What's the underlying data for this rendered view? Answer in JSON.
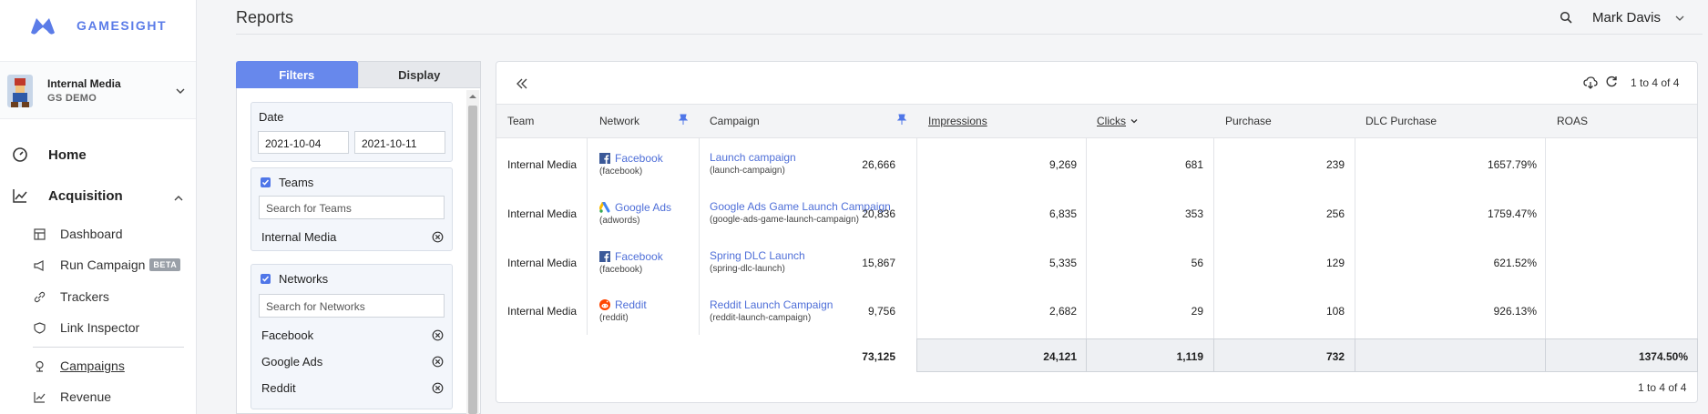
{
  "brand": {
    "name": "GAMESIGHT"
  },
  "org": {
    "name": "Internal Media",
    "sub": "GS DEMO"
  },
  "nav": {
    "home": "Home",
    "acquisition": "Acquisition",
    "dashboard": "Dashboard",
    "run_campaign": "Run Campaign",
    "beta": "BETA",
    "trackers": "Trackers",
    "link_inspector": "Link Inspector",
    "campaigns": "Campaigns",
    "revenue": "Revenue"
  },
  "header": {
    "title": "Reports",
    "user": "Mark Davis"
  },
  "filters": {
    "tab_filters": "Filters",
    "tab_display": "Display",
    "date_label": "Date",
    "date_start": "2021-10-04",
    "date_end": "2021-10-11",
    "teams_label": "Teams",
    "teams_placeholder": "Search for Teams",
    "teams_selected": [
      "Internal Media"
    ],
    "networks_label": "Networks",
    "networks_placeholder": "Search for Networks",
    "networks_selected": [
      "Facebook",
      "Google Ads",
      "Reddit"
    ]
  },
  "table": {
    "pager_top": "1 to 4 of 4",
    "pager_bottom": "1 to 4 of 4",
    "columns": [
      "Team",
      "Network",
      "Campaign",
      "Impressions",
      "Clicks",
      "Purchase",
      "DLC Purchase",
      "ROAS"
    ],
    "rows": [
      {
        "team": "Internal Media",
        "network": "Facebook",
        "network_slug": "(facebook)",
        "campaign": "Launch campaign",
        "campaign_slug": "(launch-campaign)",
        "impressions": "26,666",
        "clicks": "9,269",
        "purchase": "681",
        "dlc": "239",
        "roas": "1657.79%"
      },
      {
        "team": "Internal Media",
        "network": "Google Ads",
        "network_slug": "(adwords)",
        "campaign": "Google Ads Game Launch Campaign",
        "campaign_slug": "(google-ads-game-launch-campaign)",
        "impressions": "20,836",
        "clicks": "6,835",
        "purchase": "353",
        "dlc": "256",
        "roas": "1759.47%"
      },
      {
        "team": "Internal Media",
        "network": "Facebook",
        "network_slug": "(facebook)",
        "campaign": "Spring DLC Launch",
        "campaign_slug": "(spring-dlc-launch)",
        "impressions": "15,867",
        "clicks": "5,335",
        "purchase": "56",
        "dlc": "129",
        "roas": "621.52%"
      },
      {
        "team": "Internal Media",
        "network": "Reddit",
        "network_slug": "(reddit)",
        "campaign": "Reddit Launch Campaign",
        "campaign_slug": "(reddit-launch-campaign)",
        "impressions": "9,756",
        "clicks": "2,682",
        "purchase": "29",
        "dlc": "108",
        "roas": "926.13%"
      }
    ],
    "totals": {
      "impressions": "73,125",
      "clicks": "24,121",
      "purchase": "1,119",
      "dlc": "732",
      "roas": "1374.50%"
    }
  },
  "colors": {
    "accent": "#6788ec",
    "link": "#4f6fd8",
    "facebook": "#3b5998",
    "reddit": "#ff4500"
  }
}
